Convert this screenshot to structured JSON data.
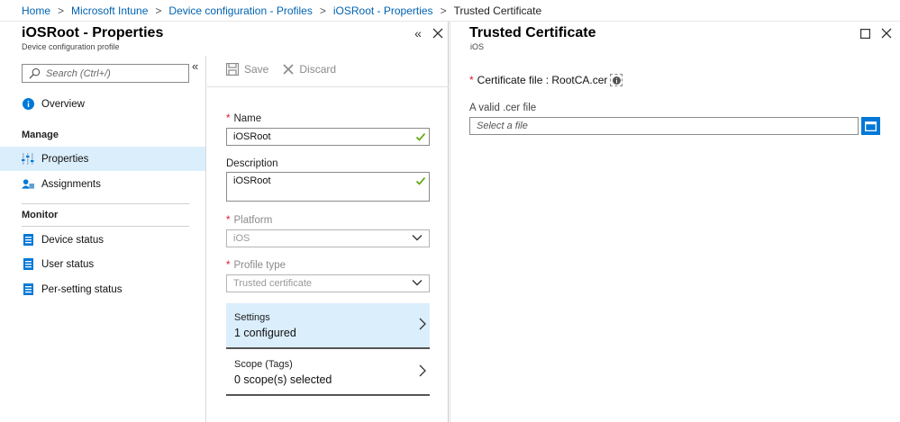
{
  "breadcrumb": {
    "items": [
      "Home",
      "Microsoft Intune",
      "Device configuration - Profiles",
      "iOSRoot - Properties"
    ],
    "current": "Trusted Certificate"
  },
  "left_blade": {
    "title": "iOSRoot - Properties",
    "subtitle": "Device configuration profile"
  },
  "nav": {
    "search_placeholder": "Search (Ctrl+/)",
    "overview": "Overview",
    "manage_header": "Manage",
    "properties": "Properties",
    "assignments": "Assignments",
    "monitor_header": "Monitor",
    "device_status": "Device status",
    "user_status": "User status",
    "per_setting_status": "Per-setting status"
  },
  "toolbar": {
    "save_label": "Save",
    "discard_label": "Discard"
  },
  "form": {
    "name_label": "Name",
    "name_value": "iOSRoot",
    "description_label": "Description",
    "description_value": "iOSRoot",
    "platform_label": "Platform",
    "platform_value": "iOS",
    "profile_type_label": "Profile type",
    "profile_type_value": "Trusted certificate",
    "required_marker": "*"
  },
  "cards": {
    "settings_title": "Settings",
    "settings_value": "1 configured",
    "scope_title": "Scope (Tags)",
    "scope_value": "0 scope(s) selected"
  },
  "right_blade": {
    "title": "Trusted Certificate",
    "subtitle": "iOS",
    "cert_label": "Certificate file : RootCA.cer",
    "file_label": "A valid .cer file",
    "file_placeholder": "Select a file"
  },
  "colors": {
    "accent": "#0078d7",
    "link": "#0063b1",
    "selected_bg": "#dbeefc",
    "required": "#e81123",
    "check": "#57a300"
  },
  "icons": [
    "search-icon",
    "info-icon",
    "properties-icon",
    "assignments-icon",
    "device-status-icon",
    "user-status-icon",
    "per-setting-status-icon",
    "save-icon",
    "discard-icon",
    "checkmark-icon",
    "chevron-down-icon",
    "chevron-right-icon",
    "maximize-icon",
    "close-icon",
    "collapse-icon",
    "folder-icon"
  ]
}
